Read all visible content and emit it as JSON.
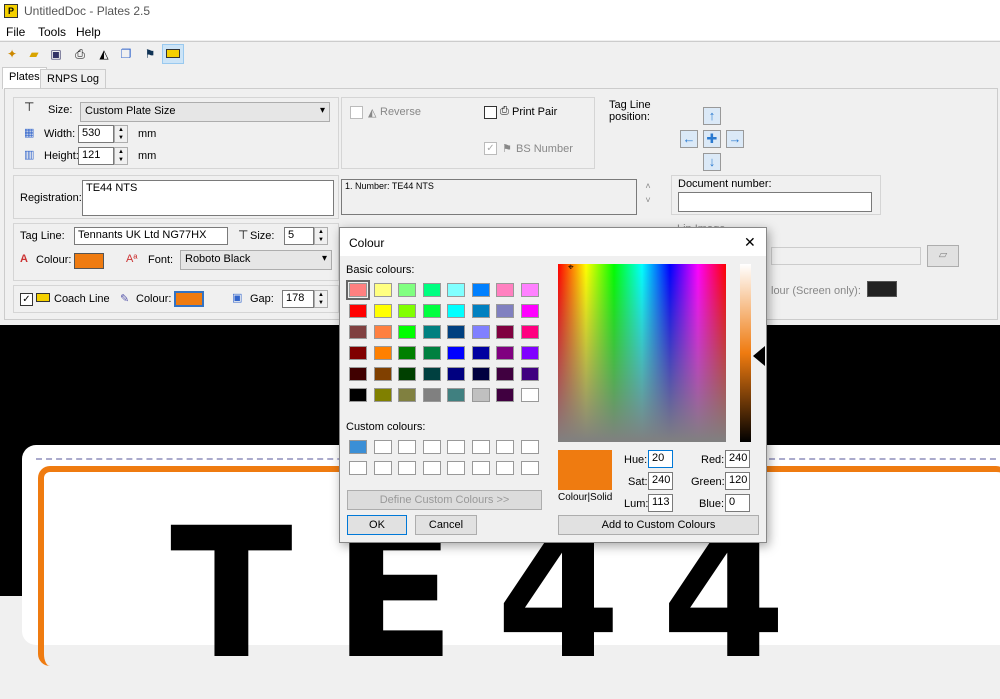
{
  "app": {
    "icon_letter": "P",
    "title": "UntitledDoc - Plates 2.5"
  },
  "menu": [
    "File",
    "Tools",
    "Help"
  ],
  "tabs": [
    "Plates",
    "RNPS Log"
  ],
  "plate_settings": {
    "size_label": "Size:",
    "size_value": "Custom Plate Size",
    "width_label": "Width:",
    "width_value": "530",
    "width_unit": "mm",
    "height_label": "Height:",
    "height_value": "121",
    "height_unit": "mm",
    "reverse_label": "Reverse",
    "print_pair_label": "Print Pair",
    "bs_number_label": "BS Number",
    "tag_line_pos_label": "Tag Line position:"
  },
  "registration": {
    "label": "Registration:",
    "value": "TE44 NTS",
    "list_item": "1. Number: TE44 NTS"
  },
  "document_number": {
    "label": "Document number:",
    "value": ""
  },
  "tagline": {
    "label": "Tag Line:",
    "value": "Tennants UK Ltd NG77HX",
    "size_label": "Size:",
    "size_value": "5",
    "colour_label": "Colour:",
    "font_label": "Font:",
    "font_value": "Roboto Black"
  },
  "coachline": {
    "label": "Coach Line",
    "colour_label": "Colour:",
    "gap_label": "Gap:",
    "gap_value": "178"
  },
  "partial": {
    "lip_image": "Lip Image",
    "colour_screen": "lour (Screen only):"
  },
  "plate_preview": {
    "text": "TE44"
  },
  "colors": {
    "orange": "#ef7b10",
    "dark": "#222222"
  },
  "dialog": {
    "title": "Colour",
    "close": "✕",
    "basic_label": "Basic colours:",
    "custom_label": "Custom colours:",
    "basic_colours": [
      "#ff8080",
      "#ffff80",
      "#80ff80",
      "#00ff80",
      "#80ffff",
      "#0080ff",
      "#ff80c0",
      "#ff80ff",
      "#ff0000",
      "#ffff00",
      "#80ff00",
      "#00ff40",
      "#00ffff",
      "#0080c0",
      "#8080c0",
      "#ff00ff",
      "#804040",
      "#ff8040",
      "#00ff00",
      "#008080",
      "#004080",
      "#8080ff",
      "#800040",
      "#ff0080",
      "#800000",
      "#ff8000",
      "#008000",
      "#008040",
      "#0000ff",
      "#0000a0",
      "#800080",
      "#8000ff",
      "#400000",
      "#804000",
      "#004000",
      "#004040",
      "#000080",
      "#000040",
      "#400040",
      "#400080",
      "#000000",
      "#808000",
      "#808040",
      "#808080",
      "#408080",
      "#c0c0c0",
      "#400040",
      "#ffffff"
    ],
    "custom_first": "#3b8fd6",
    "define_btn": "Define Custom Colours >>",
    "ok_btn": "OK",
    "cancel_btn": "Cancel",
    "colour_solid": "Colour|Solid",
    "hue_label": "Hue:",
    "hue": "20",
    "sat_label": "Sat:",
    "sat": "240",
    "lum_label": "Lum:",
    "lum": "113",
    "red_label": "Red:",
    "red": "240",
    "green_label": "Green:",
    "green": "120",
    "blue_label": "Blue:",
    "blue": "0",
    "add_btn": "Add to Custom Colours"
  }
}
